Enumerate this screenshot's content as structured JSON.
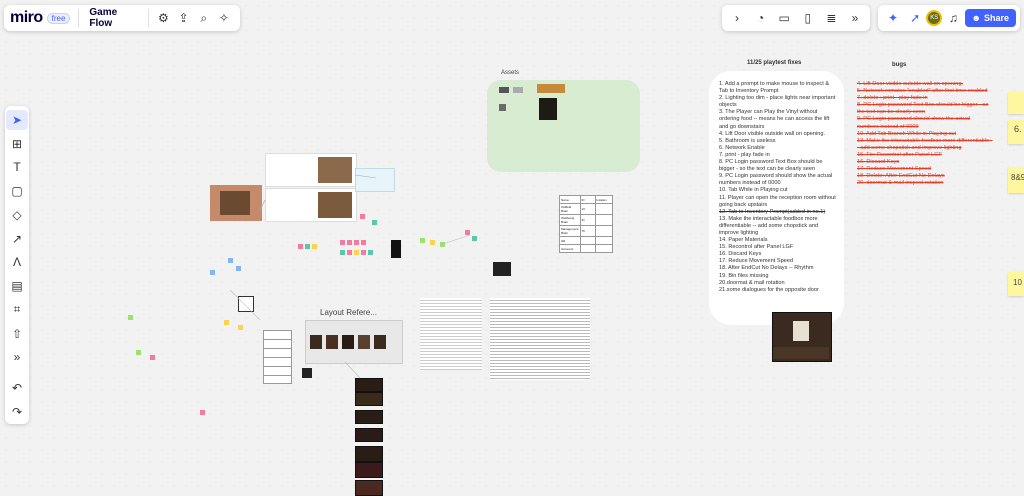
{
  "topbar": {
    "logo": "miro",
    "plan_badge": "free",
    "board_name": "Game Flow",
    "icons": [
      "settings-icon",
      "upload-icon",
      "search-icon",
      "magic-icon"
    ]
  },
  "right_toolbar": {
    "icons": [
      "chevron-right-icon",
      "timer-icon",
      "comment-icon",
      "slide-icon",
      "notes-icon",
      "more-icon"
    ],
    "user_initials": "KS",
    "share_label": "Share"
  },
  "tools": [
    "select",
    "frame",
    "text",
    "sticky-note",
    "shapes",
    "arrow",
    "pen",
    "comment",
    "crop",
    "upload",
    "more",
    "undo",
    "redo"
  ],
  "canvas": {
    "assets_label": "Assets",
    "playtest_title": "11/25 playtest fixes",
    "bugs_title": "bugs",
    "layout_label": "Layout Refere...",
    "table": {
      "headers": [
        "Name",
        "ID",
        "location"
      ],
      "rows": [
        [
          "Oldfield Brain",
          "1C",
          ""
        ],
        [
          "Wellbeing Brain",
          "31",
          ""
        ],
        [
          "Management Brain",
          "76",
          ""
        ],
        [
          "HR",
          "",
          ""
        ],
        [
          "Accounts",
          "",
          ""
        ]
      ]
    },
    "playtest_items": [
      "1. Add a prompt to make mouse to inspect & Tab to  Inventory Prompt",
      "2. Lighting too dim - place lights near important objects",
      "3. The Player can Play the Vinyl without ordering food -- means he can access the lift and go downstairs",
      "4. Lift Door visible outside wall on opening.",
      "5. Bathroom is useless",
      "6. Network Enable",
      "7. print - play fade in",
      "8. PC Login password Text Box should be bigger - so the text can be clearly seen",
      "9. PC Login password should show the actual numbers instead of 0000",
      "10. Tab While in Playing cut",
      "11. Player can open the reception room without going back upstairs",
      "12. Tab to  Inventory Prompt(added in no.1)",
      "13. Make the interactable foodbox more differentiable -- add some chopstick and improve lighting",
      "14. Paper Materials",
      "15. Recontrol after Panel LGF",
      "16. Discard Keys",
      "17. Reduce Movement Speed",
      "18. After EndCut No Delays -- Rhythm",
      "19. Bin files missing",
      "20.doormat & mail rotation",
      "21.some dialogues for the opposite door"
    ],
    "bug_items": [
      "4. Lift Door visible outside wall on opening.",
      "5. Network remains \"enabled\" after first time enabled",
      "7. delete : print - play fade in",
      "8. PC Login password Text Box should be bigger - so the text can be clearly seen",
      "9. PC Login password should show the actual numbers instead of 0000",
      "10. Add Tab Branch While in Playing cut",
      "13. Make the interactable foodbox more differentiable -- add some chopstick and improve lighting",
      "15. Fix: Recontrol after Panel LGF",
      "16. Discard Keys",
      "17. Reduce Movement Speed",
      "18. Delete: After EndCut No Delays",
      "20. doormat & mail inspect rotation"
    ],
    "right_stickies": [
      "6.",
      "8&9",
      "10"
    ],
    "colors": {
      "assets_frame": "#d7ecd0",
      "bug_red": "#e0402a",
      "brand_blue": "#4262ff",
      "sticky_yellow": "#fff7a0"
    }
  }
}
